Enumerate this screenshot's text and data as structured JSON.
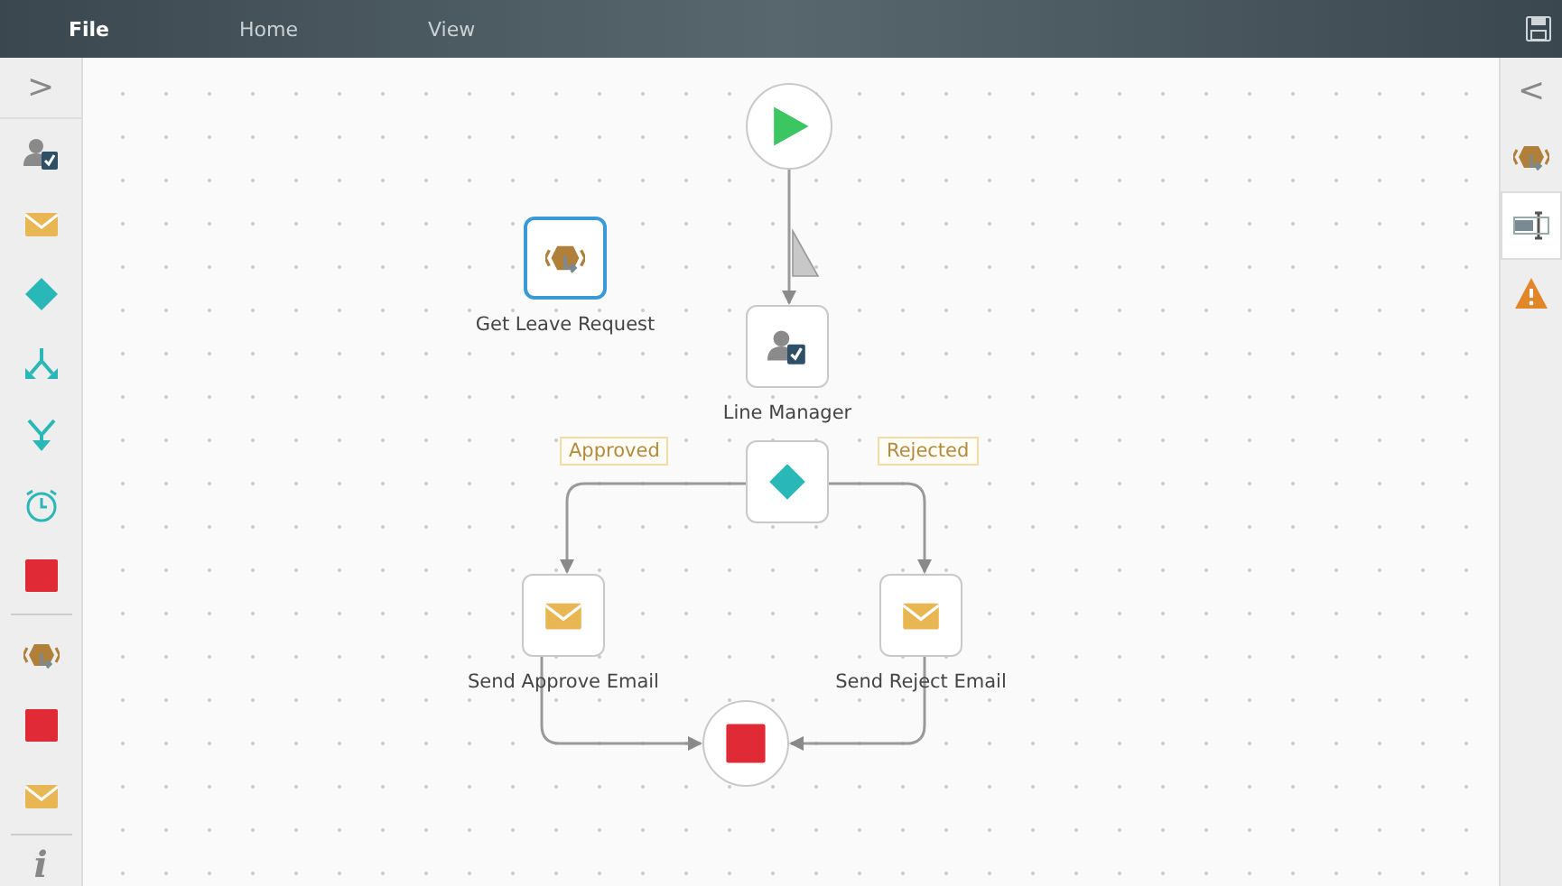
{
  "menu": [
    {
      "label": "File",
      "selected": true
    },
    {
      "label": "Home",
      "selected": false
    },
    {
      "label": "View",
      "selected": false
    }
  ],
  "left_toolbar": {
    "toggle": ">",
    "items": [
      {
        "kind": "user-task"
      },
      {
        "kind": "email"
      },
      {
        "kind": "decision"
      },
      {
        "kind": "split"
      },
      {
        "kind": "merge"
      },
      {
        "kind": "timer"
      },
      {
        "kind": "end"
      },
      {
        "kind": "divider"
      },
      {
        "kind": "service"
      },
      {
        "kind": "end"
      },
      {
        "kind": "email"
      },
      {
        "kind": "divider"
      }
    ],
    "info": "i"
  },
  "nodes": [
    {
      "kind": "start",
      "selected": false
    },
    {
      "kind": "service",
      "label": "Get Leave Request",
      "selected": true
    },
    {
      "kind": "user-task",
      "label": "Line Manager",
      "selected": false
    },
    {
      "kind": "decision",
      "selected": false
    },
    {
      "kind": "email",
      "label": "Send Approve Email",
      "selected": false
    },
    {
      "kind": "email",
      "label": "Send Reject Email",
      "selected": false
    },
    {
      "kind": "end",
      "selected": false
    }
  ],
  "tags": [
    {
      "label": "Approved"
    },
    {
      "label": "Rejected"
    }
  ],
  "right_panel": {
    "toggle": "<",
    "items": [
      {
        "kind": "service",
        "selected": false
      },
      {
        "kind": "properties",
        "selected": true
      },
      {
        "kind": "warning",
        "selected": false
      }
    ]
  }
}
